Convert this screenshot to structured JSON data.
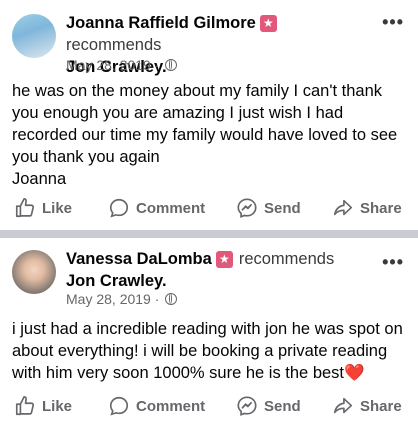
{
  "posts": [
    {
      "author": "Joanna Raffield Gilmore",
      "action": "recommends",
      "target": "Jon Crawley.",
      "date": "May 28, 2019 · ",
      "body": "he was on the money about my family I can't thank you enough you are amazing I just wish I had recorded our time my family would have loved to see you thank you again\nJoanna",
      "body_suffix": ""
    },
    {
      "author": "Vanessa DaLomba",
      "action": "recommends",
      "target": "Jon Crawley.",
      "date": "May 28, 2019 · ",
      "body": "i just had a incredible reading with jon he was spot on about everything! i will be booking a private reading with him very soon 1000% sure he is the best",
      "body_suffix": "❤️"
    }
  ],
  "actions": {
    "like": "Like",
    "comment": "Comment",
    "send": "Send",
    "share": "Share"
  },
  "colors": {
    "text": "#050505",
    "secondary": "#65676b",
    "badge": "#e2587a",
    "separator": "#c9ccd1"
  }
}
